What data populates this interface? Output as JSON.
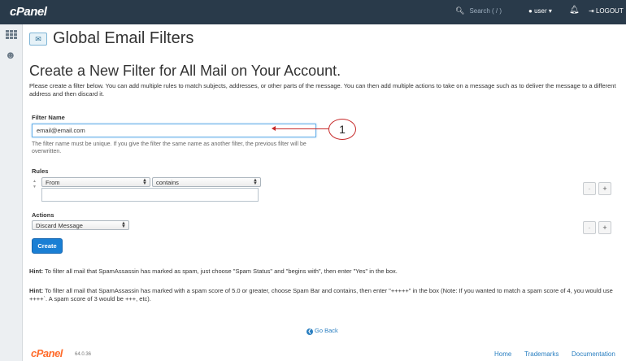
{
  "topbar": {
    "logo": "cPanel",
    "search_placeholder": "Search ( / )",
    "user_label": "user",
    "logout_label": "LOGOUT"
  },
  "page": {
    "title": "Global Email Filters",
    "section_title": "Create a New Filter for All Mail on Your Account.",
    "intro": "Please create a filter below. You can add multiple rules to match subjects, addresses, or other parts of the message. You can then add multiple actions to take on a message such as to deliver the message to a different address and then discard it."
  },
  "filter_name": {
    "label": "Filter Name",
    "value": "email@email.com",
    "help": "The filter name must be unique. If you give the filter the same name as another filter, the previous filter will be overwritten."
  },
  "rules": {
    "label": "Rules",
    "field_selected": "From",
    "operator_selected": "contains",
    "value": "",
    "remove_label": "-",
    "add_label": "+"
  },
  "actions": {
    "label": "Actions",
    "action_selected": "Discard Message",
    "remove_label": "-",
    "add_label": "+"
  },
  "create_button": "Create",
  "hints": [
    {
      "prefix": "Hint:",
      "text": " To filter all mail that SpamAssassin has marked as spam, just choose \"Spam Status\" and \"begins with\", then enter \"Yes\" in the box."
    },
    {
      "prefix": "Hint:",
      "text": " To filter all mail that SpamAssassin has marked with a spam score of 5.0 or greater, choose Spam Bar and contains, then enter \"+++++\" in the box (Note: If you wanted to match a spam score of 4, you would use ++++`. A spam score of 3 would be +++, etc)."
    }
  ],
  "go_back": "Go Back",
  "footer": {
    "logo": "cPanel",
    "version": "64.0.36",
    "links": [
      "Home",
      "Trademarks",
      "Documentation"
    ]
  },
  "callout": {
    "number": "1",
    "color": "#c62828"
  },
  "colors": {
    "topbar": "#293a4a",
    "accent": "#1a7fd4",
    "footer_logo": "#ff6c2c"
  }
}
